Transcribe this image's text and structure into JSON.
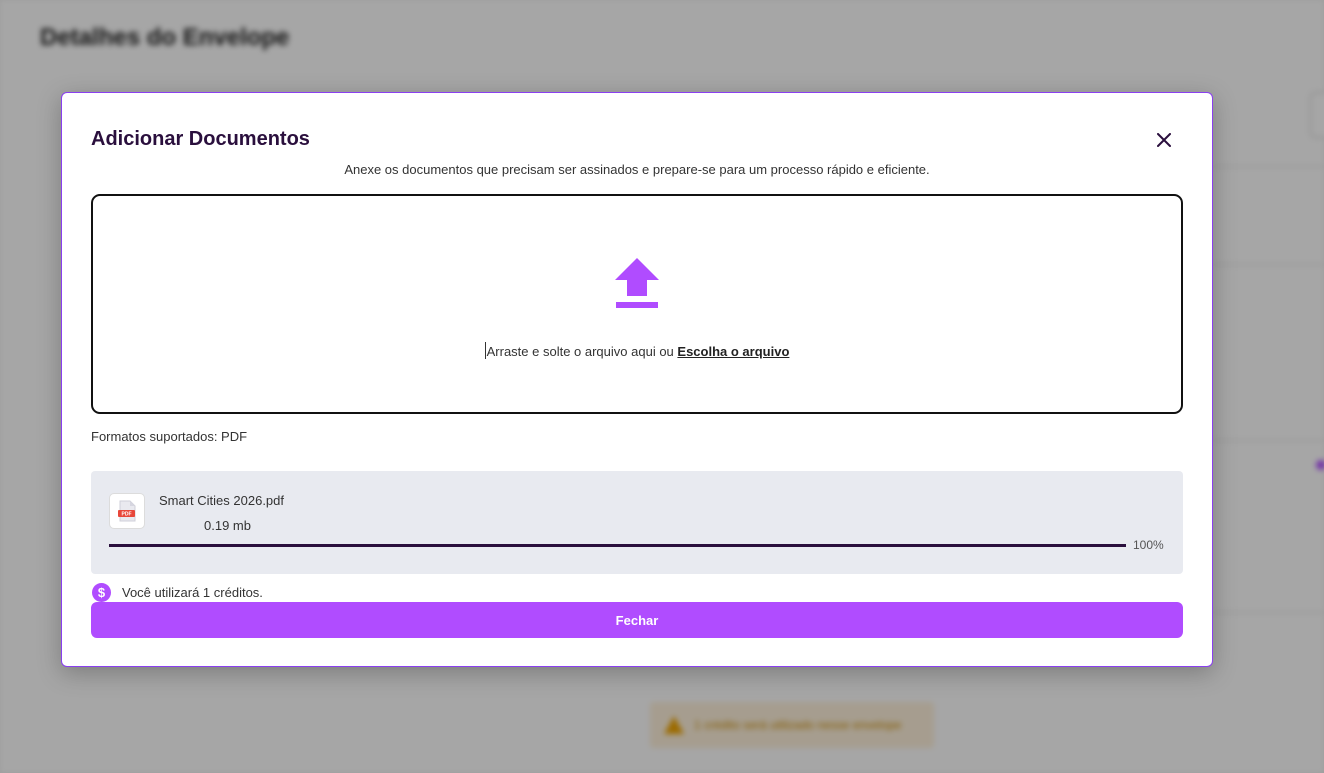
{
  "background": {
    "page_title": "Detalhes do Envelope",
    "warning_text": "1 crédito será utilizado nesse envelope"
  },
  "modal": {
    "title": "Adicionar Documentos",
    "subtitle": "Anexe os documentos que precisam ser assinados e prepare-se para um processo rápido e eficiente.",
    "dropzone": {
      "text": "Arraste e solte o arquivo aqui ou",
      "link": "Escolha o arquivo",
      "icon": "upload-icon"
    },
    "formats_label": "Formatos suportados: PDF",
    "file": {
      "name": "Smart Cities 2026.pdf",
      "size": "0.19 mb",
      "progress": 100,
      "progress_label": "100%",
      "type_badge": "PDF"
    },
    "credits_text": "Você utilizará 1 créditos.",
    "close_button": "Fechar"
  },
  "colors": {
    "accent": "#b04cff",
    "title": "#2a0f3d",
    "progress": "#2a0f3d",
    "pdf_red": "#e8473a"
  }
}
